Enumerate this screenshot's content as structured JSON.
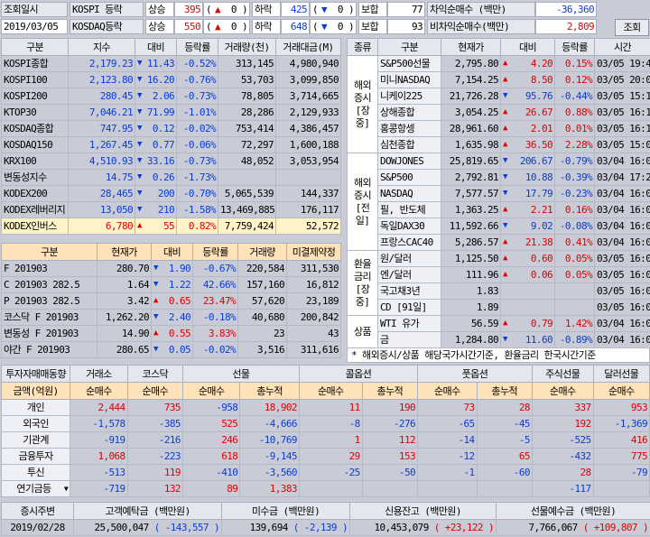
{
  "top": {
    "label1": "조회일시",
    "date": "2019/03/05",
    "rows": [
      {
        "name": "KOSPI 등락",
        "up_label": "상승",
        "up_val": "395",
        "up_in": "0",
        "dn_label": "하락",
        "dn_val": "425",
        "dn_in": "0",
        "flat_label": "보합",
        "flat_val": "77"
      },
      {
        "name": "KOSDAQ등락",
        "up_label": "상승",
        "up_val": "550",
        "up_in": "0",
        "dn_label": "하락",
        "dn_val": "648",
        "dn_in": "0",
        "flat_label": "보합",
        "flat_val": "93"
      }
    ],
    "arb": [
      {
        "label": "차익순매수 (백만)",
        "value": "-36,360"
      },
      {
        "label": "비차익순매수(백만)",
        "value": "2,809"
      }
    ],
    "query_btn": "조회"
  },
  "index_table": {
    "headers": [
      "구분",
      "지수",
      "대비",
      "등락률",
      "거래량(천)",
      "거래대금(M)"
    ],
    "rows": [
      [
        "KOSPI종합",
        "2,179.23",
        "▼",
        "11.43",
        "-0.52%",
        "313,145",
        "4,980,940",
        "dn"
      ],
      [
        "KOSPI100",
        "2,123.80",
        "▼",
        "16.20",
        "-0.76%",
        "53,703",
        "3,099,850",
        "dn"
      ],
      [
        "KOSPI200",
        "280.45",
        "▼",
        "2.06",
        "-0.73%",
        "78,805",
        "3,714,665",
        "dn"
      ],
      [
        "KTOP30",
        "7,046.21",
        "▼",
        "71.99",
        "-1.01%",
        "28,286",
        "2,129,933",
        "dn"
      ],
      [
        "KOSDAQ종합",
        "747.95",
        "▼",
        "0.12",
        "-0.02%",
        "753,414",
        "4,386,457",
        "dn"
      ],
      [
        "KOSDAQ150",
        "1,267.45",
        "▼",
        "0.77",
        "-0.06%",
        "72,297",
        "1,600,188",
        "dn"
      ],
      [
        "KRX100",
        "4,510.93",
        "▼",
        "33.16",
        "-0.73%",
        "48,052",
        "3,053,954",
        "dn"
      ],
      [
        "변동성지수",
        "14.75",
        "▼",
        "0.26",
        "-1.73%",
        "",
        "",
        "dn"
      ],
      [
        "KODEX200",
        "28,465",
        "▼",
        "200",
        "-0.70%",
        "5,065,539",
        "144,337",
        "dn"
      ],
      [
        "KODEX레버리지",
        "13,050",
        "▼",
        "210",
        "-1.58%",
        "13,469,885",
        "176,117",
        "dn"
      ],
      [
        "KODEX인버스",
        "6,780",
        "▲",
        "55",
        "0.82%",
        "7,759,424",
        "52,572",
        "up"
      ]
    ]
  },
  "deriv_table": {
    "headers": [
      "구분",
      "현재가",
      "대비",
      "등락률",
      "거래량",
      "미결제약정"
    ],
    "rows": [
      [
        "F 201903",
        "280.70",
        "▼",
        "1.90",
        "-0.67%",
        "220,584",
        "311,530",
        "dn"
      ],
      [
        "C 201903 282.5",
        "1.64",
        "▼",
        "1.22",
        "42.66%",
        "157,160",
        "16,812",
        "dn"
      ],
      [
        "P 201903 282.5",
        "3.42",
        "▲",
        "0.65",
        "23.47%",
        "57,620",
        "23,189",
        "up"
      ],
      [
        "코스닥 F 201903",
        "1,262.20",
        "▼",
        "2.40",
        "-0.18%",
        "40,680",
        "200,842",
        "dn"
      ],
      [
        "변동성 F 201903",
        "14.90",
        "▲",
        "0.55",
        "3.83%",
        "23",
        "43",
        "up"
      ],
      [
        "야간 F 201903",
        "280.65",
        "▼",
        "0.05",
        "-0.02%",
        "3,516",
        "311,616",
        "dn"
      ]
    ]
  },
  "world_table": {
    "headers": [
      "종류",
      "구분",
      "현재가",
      "대비",
      "등락률",
      "시간"
    ],
    "groups": [
      {
        "label": "해외\n증시\n[장중]",
        "rows": [
          [
            "S&P500선물",
            "2,795.80",
            "▲",
            "4.20",
            "0.15%",
            "03/05 19:42",
            "up"
          ],
          [
            "미니NASDAQ",
            "7,154.25",
            "▲",
            "8.50",
            "0.12%",
            "03/05 20:07",
            "up"
          ],
          [
            "니케이225",
            "21,726.28",
            "▼",
            "95.76",
            "-0.44%",
            "03/05 15:15",
            "dn"
          ],
          [
            "상해종합",
            "3,054.25",
            "▲",
            "26.67",
            "0.88%",
            "03/05 16:15",
            "up"
          ],
          [
            "홍콩항셍",
            "28,961.60",
            "▲",
            "2.01",
            "0.01%",
            "03/05 16:13",
            "up"
          ],
          [
            "심천종합",
            "1,635.98",
            "▲",
            "36.50",
            "2.28%",
            "03/05 15:00",
            "up"
          ]
        ]
      },
      {
        "label": "해외\n증시\n[전일]",
        "rows": [
          [
            "DOWJONES",
            "25,819.65",
            "▼",
            "206.67",
            "-0.79%",
            "03/04 16:00",
            "dn"
          ],
          [
            "S&P500",
            "2,792.81",
            "▼",
            "10.88",
            "-0.39%",
            "03/04 17:24",
            "dn"
          ],
          [
            "NASDAQ",
            "7,577.57",
            "▼",
            "17.79",
            "-0.23%",
            "03/04 16:01",
            "dn"
          ],
          [
            "필, 반도체",
            "1,363.25",
            "▲",
            "2.21",
            "0.16%",
            "03/04 16:01",
            "up"
          ],
          [
            "독일DAX30",
            "11,592.66",
            "▼",
            "9.02",
            "-0.08%",
            "03/04 16:00",
            "dn"
          ],
          [
            "프랑스CAC40",
            "5,286.57",
            "▲",
            "21.38",
            "0.41%",
            "03/04 16:00",
            "up"
          ]
        ]
      },
      {
        "label": "환율\n금리\n[장중]",
        "rows": [
          [
            "원/달러",
            "1,125.50",
            "▲",
            "0.60",
            "0.05%",
            "03/05 16:00",
            "up"
          ],
          [
            "엔/달러",
            "111.96",
            "▲",
            "0.06",
            "0.05%",
            "03/05 16:00",
            "up"
          ],
          [
            "국고채3년",
            "1.83",
            "",
            "",
            "",
            "03/05 16:00",
            "up"
          ],
          [
            "CD [91일]",
            "1.89",
            "",
            "",
            "",
            "03/05 16:00",
            "up"
          ]
        ]
      },
      {
        "label": "상품",
        "rows": [
          [
            "WTI 유가",
            "56.59",
            "▲",
            "0.79",
            "1.42%",
            "03/04 16:00",
            "up"
          ],
          [
            "금",
            "1,284.80",
            "▼",
            "11.60",
            "-0.89%",
            "03/04 16:00",
            "dn"
          ]
        ]
      }
    ],
    "note": "* 해외증시/상품 해당국가시간기준, 환율금리 한국시간기준"
  },
  "investor": {
    "title": "투자자매매동향",
    "cols": [
      "거래소",
      "코스닥",
      "선물",
      "콜옵션",
      "풋옵션",
      "주식선물",
      "달러선물"
    ],
    "sub_first": "금액(억원)",
    "subs": [
      "순매수",
      "순매수",
      "순매수",
      "총누적",
      "순매수",
      "총누적",
      "순매수",
      "총누적",
      "순매수",
      "순매수"
    ],
    "rows": [
      [
        "개인",
        "2,444",
        "735",
        "-958",
        "18,902",
        "11",
        "190",
        "73",
        "28",
        "337",
        "953"
      ],
      [
        "외국인",
        "-1,578",
        "-385",
        "525",
        "-4,666",
        "-8",
        "-276",
        "-65",
        "-45",
        "192",
        "-1,369"
      ],
      [
        "기관계",
        "-919",
        "-216",
        "246",
        "-10,769",
        "1",
        "112",
        "-14",
        "-5",
        "-525",
        "416"
      ],
      [
        "금융투자",
        "1,068",
        "-223",
        "618",
        "-9,145",
        "29",
        "153",
        "-12",
        "65",
        "-432",
        "775"
      ],
      [
        "투신",
        "-513",
        "119",
        "-410",
        "-3,560",
        "-25",
        "-50",
        "-1",
        "-60",
        "28",
        "-79"
      ],
      [
        "연기금등",
        "-719",
        "132",
        "89",
        "1,383",
        "",
        "",
        "",
        "",
        "-117",
        ""
      ]
    ]
  },
  "bottom": {
    "headers": [
      "증시주변",
      "고객예탁금 (백만원)",
      "미수금 (백만원)",
      "신용잔고 (백만원)",
      "선물예수금 (백만원)"
    ],
    "date": "2019/02/28",
    "vals": [
      [
        "25,500,047",
        "( -143,557 )",
        "dn"
      ],
      [
        "139,694",
        "( -2,139 )",
        "dn"
      ],
      [
        "10,453,079",
        "( +23,122 )",
        "up"
      ],
      [
        "7,766,067",
        "( +109,807 )",
        "up"
      ]
    ]
  },
  "colors": {
    "up": "#e00000",
    "down": "#0a3cd6",
    "accent": "#ffe2b8"
  }
}
